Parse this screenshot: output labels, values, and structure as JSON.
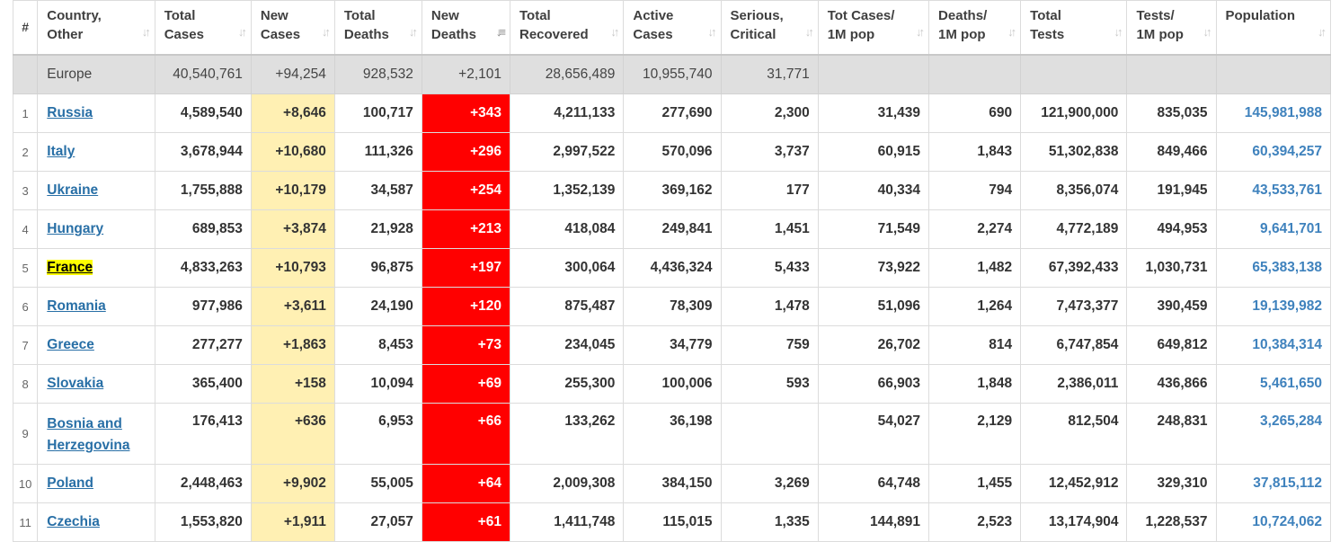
{
  "headers": [
    {
      "key": "rank",
      "lines": [
        "#"
      ],
      "sortable": false
    },
    {
      "key": "country",
      "lines": [
        "Country,",
        "Other"
      ],
      "sortable": true
    },
    {
      "key": "total_cases",
      "lines": [
        "Total",
        "Cases"
      ],
      "sortable": true
    },
    {
      "key": "new_cases",
      "lines": [
        "New",
        "Cases"
      ],
      "sortable": true
    },
    {
      "key": "total_deaths",
      "lines": [
        "Total",
        "Deaths"
      ],
      "sortable": true
    },
    {
      "key": "new_deaths",
      "lines": [
        "New",
        "Deaths"
      ],
      "sortable": true,
      "active_sort": true
    },
    {
      "key": "total_recovered",
      "lines": [
        "Total",
        "Recovered"
      ],
      "sortable": true
    },
    {
      "key": "active_cases",
      "lines": [
        "Active",
        "Cases"
      ],
      "sortable": true
    },
    {
      "key": "serious_critical",
      "lines": [
        "Serious,",
        "Critical"
      ],
      "sortable": true
    },
    {
      "key": "tot_cases_1m",
      "lines": [
        "Tot Cases/",
        "1M pop"
      ],
      "sortable": true
    },
    {
      "key": "deaths_1m",
      "lines": [
        "Deaths/",
        "1M pop"
      ],
      "sortable": true
    },
    {
      "key": "total_tests",
      "lines": [
        "Total",
        "Tests"
      ],
      "sortable": true
    },
    {
      "key": "tests_1m",
      "lines": [
        "Tests/",
        "1M pop"
      ],
      "sortable": true
    },
    {
      "key": "population",
      "lines": [
        "Population"
      ],
      "sortable": true
    }
  ],
  "sort_icon": "sort-arrows-icon",
  "sort_icon_active": "sort-desc-icon",
  "colors": {
    "new_cases_bg": "#fff0b3",
    "new_deaths_bg": "#ff0000",
    "link": "#286fa6",
    "population": "#3f82bd",
    "highlight": "#ffff00",
    "total_row_bg": "#dfdfdf"
  },
  "total_row": {
    "country": "Europe",
    "total_cases": "40,540,761",
    "new_cases": "+94,254",
    "total_deaths": "928,532",
    "new_deaths": "+2,101",
    "total_recovered": "28,656,489",
    "active_cases": "10,955,740",
    "serious_critical": "31,771",
    "tot_cases_1m": "",
    "deaths_1m": "",
    "total_tests": "",
    "tests_1m": "",
    "population": ""
  },
  "rows": [
    {
      "rank": "1",
      "country": "Russia",
      "total_cases": "4,589,540",
      "new_cases": "+8,646",
      "total_deaths": "100,717",
      "new_deaths": "+343",
      "total_recovered": "4,211,133",
      "active_cases": "277,690",
      "serious_critical": "2,300",
      "tot_cases_1m": "31,439",
      "deaths_1m": "690",
      "total_tests": "121,900,000",
      "tests_1m": "835,035",
      "population": "145,981,988"
    },
    {
      "rank": "2",
      "country": "Italy",
      "total_cases": "3,678,944",
      "new_cases": "+10,680",
      "total_deaths": "111,326",
      "new_deaths": "+296",
      "total_recovered": "2,997,522",
      "active_cases": "570,096",
      "serious_critical": "3,737",
      "tot_cases_1m": "60,915",
      "deaths_1m": "1,843",
      "total_tests": "51,302,838",
      "tests_1m": "849,466",
      "population": "60,394,257"
    },
    {
      "rank": "3",
      "country": "Ukraine",
      "total_cases": "1,755,888",
      "new_cases": "+10,179",
      "total_deaths": "34,587",
      "new_deaths": "+254",
      "total_recovered": "1,352,139",
      "active_cases": "369,162",
      "serious_critical": "177",
      "tot_cases_1m": "40,334",
      "deaths_1m": "794",
      "total_tests": "8,356,074",
      "tests_1m": "191,945",
      "population": "43,533,761"
    },
    {
      "rank": "4",
      "country": "Hungary",
      "total_cases": "689,853",
      "new_cases": "+3,874",
      "total_deaths": "21,928",
      "new_deaths": "+213",
      "total_recovered": "418,084",
      "active_cases": "249,841",
      "serious_critical": "1,451",
      "tot_cases_1m": "71,549",
      "deaths_1m": "2,274",
      "total_tests": "4,772,189",
      "tests_1m": "494,953",
      "population": "9,641,701"
    },
    {
      "rank": "5",
      "country": "France",
      "highlight": true,
      "total_cases": "4,833,263",
      "new_cases": "+10,793",
      "total_deaths": "96,875",
      "new_deaths": "+197",
      "total_recovered": "300,064",
      "active_cases": "4,436,324",
      "serious_critical": "5,433",
      "tot_cases_1m": "73,922",
      "deaths_1m": "1,482",
      "total_tests": "67,392,433",
      "tests_1m": "1,030,731",
      "population": "65,383,138"
    },
    {
      "rank": "6",
      "country": "Romania",
      "total_cases": "977,986",
      "new_cases": "+3,611",
      "total_deaths": "24,190",
      "new_deaths": "+120",
      "total_recovered": "875,487",
      "active_cases": "78,309",
      "serious_critical": "1,478",
      "tot_cases_1m": "51,096",
      "deaths_1m": "1,264",
      "total_tests": "7,473,377",
      "tests_1m": "390,459",
      "population": "19,139,982"
    },
    {
      "rank": "7",
      "country": "Greece",
      "total_cases": "277,277",
      "new_cases": "+1,863",
      "total_deaths": "8,453",
      "new_deaths": "+73",
      "total_recovered": "234,045",
      "active_cases": "34,779",
      "serious_critical": "759",
      "tot_cases_1m": "26,702",
      "deaths_1m": "814",
      "total_tests": "6,747,854",
      "tests_1m": "649,812",
      "population": "10,384,314"
    },
    {
      "rank": "8",
      "country": "Slovakia",
      "total_cases": "365,400",
      "new_cases": "+158",
      "total_deaths": "10,094",
      "new_deaths": "+69",
      "total_recovered": "255,300",
      "active_cases": "100,006",
      "serious_critical": "593",
      "tot_cases_1m": "66,903",
      "deaths_1m": "1,848",
      "total_tests": "2,386,011",
      "tests_1m": "436,866",
      "population": "5,461,650"
    },
    {
      "rank": "9",
      "country": "Bosnia and Herzegovina",
      "tall": true,
      "total_cases": "176,413",
      "new_cases": "+636",
      "total_deaths": "6,953",
      "new_deaths": "+66",
      "total_recovered": "133,262",
      "active_cases": "36,198",
      "serious_critical": "",
      "tot_cases_1m": "54,027",
      "deaths_1m": "2,129",
      "total_tests": "812,504",
      "tests_1m": "248,831",
      "population": "3,265,284"
    },
    {
      "rank": "10",
      "country": "Poland",
      "total_cases": "2,448,463",
      "new_cases": "+9,902",
      "total_deaths": "55,005",
      "new_deaths": "+64",
      "total_recovered": "2,009,308",
      "active_cases": "384,150",
      "serious_critical": "3,269",
      "tot_cases_1m": "64,748",
      "deaths_1m": "1,455",
      "total_tests": "12,452,912",
      "tests_1m": "329,310",
      "population": "37,815,112"
    },
    {
      "rank": "11",
      "country": "Czechia",
      "total_cases": "1,553,820",
      "new_cases": "+1,911",
      "total_deaths": "27,057",
      "new_deaths": "+61",
      "total_recovered": "1,411,748",
      "active_cases": "115,015",
      "serious_critical": "1,335",
      "tot_cases_1m": "144,891",
      "deaths_1m": "2,523",
      "total_tests": "13,174,904",
      "tests_1m": "1,228,537",
      "population": "10,724,062"
    }
  ]
}
